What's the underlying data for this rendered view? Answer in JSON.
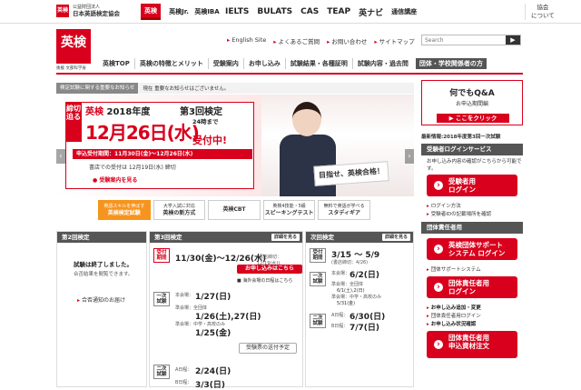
{
  "org": {
    "logo": "英検",
    "line1": "公益財団法人",
    "line2": "日本英語検定協会"
  },
  "brands": [
    "英検",
    "英検Jr.",
    "英検IBA",
    "IELTS",
    "BULATS",
    "CAS",
    "TEAP",
    "英ナビ",
    "通信講座"
  ],
  "assoc": {
    "line1": "協会",
    "line2": "について"
  },
  "logo": {
    "main": "英検",
    "sub": "後援 文部科学省"
  },
  "util": [
    "English Site",
    "よくあるご質問",
    "お問い合わせ",
    "サイトマップ"
  ],
  "search": {
    "placeholder": "Search",
    "button": "▶"
  },
  "gnav": [
    "英検TOP",
    "英検の特徴とメリット",
    "受験案内",
    "お申し込み",
    "試験結果・各種証明",
    "試験内容・過去問",
    "団体・学校関係者の方"
  ],
  "notice": {
    "label": "検定試験に関する重要なお知らせ",
    "text": "現在 重要なお知らせはございません。"
  },
  "hero": {
    "shime": "締切迫る",
    "title_a": "英検",
    "title_b": "2018年度",
    "round": "第3回検定",
    "date": "12月26日(水)",
    "until": "24時まで",
    "accept": "受付中!",
    "period": "申込受付期間：11月30日(金)〜12月26日(水)",
    "shop": "書店での受付は 12月19日(水) 締切",
    "guide": "受験案内を見る",
    "board": "目指せ、英検合格！",
    "prev": "‹",
    "next": "›"
  },
  "tabs": [
    {
      "top": "英語スキルを伸ばす",
      "main": "英検検定試験"
    },
    {
      "top": "大学入試に対応",
      "main": "英検の新方式"
    },
    {
      "top": "",
      "main": "英検CBT"
    },
    {
      "top": "英検4技能・5級",
      "main": "スピーキングテスト"
    },
    {
      "top": "無料で英語が学べる",
      "main": "スタディギア"
    }
  ],
  "col1": {
    "head": "第2回検定",
    "t1": "試験は終了しました。",
    "t2": "合否結果を閲覧できます。",
    "t3": "合否通知のお届け"
  },
  "col2": {
    "head": "第3回検定",
    "detail": "詳細を見る",
    "l_accept": "受付期間",
    "accept": "11/30(金)〜12/26(水)",
    "accept_note": "(書店締切：12/19(水))",
    "apply_btn": "お申し込みはこちら",
    "overseas": "海外会場の日程はこちら",
    "l1": "一次試験",
    "r1a": "本会場：",
    "r1b": "1/27(日)",
    "r1c": "準会場：全団体",
    "r1d": "1/26(土),27(日)",
    "r1e": "準会場：中学・高校のみ",
    "r1f": "1/25(金)",
    "ship_btn": "受験票の送付予定",
    "l2": "二次試験",
    "r2a": "A日程：",
    "r2b": "2/24(日)",
    "r2c": "B日程：",
    "r2d": "3/3(日)"
  },
  "col3": {
    "head": "次回検定",
    "detail": "詳細を見る",
    "l_accept": "受付期間",
    "accept": "3/15 〜 5/9",
    "accept_note": "(書店締切：4/26)",
    "l1": "一次試験",
    "r1a": "本会場：",
    "r1b": "6/2(日)",
    "r1c": "準会場：全団体",
    "r1d": "6/1(土),2(日)",
    "r1e": "準会場：中学・高校のみ",
    "r1f": "5/31(金)",
    "l2": "二次試験",
    "r2a": "A日程：",
    "r2b": "6/30(日)",
    "r2c": "B日程：",
    "r2d": "7/7(日)"
  },
  "side": {
    "qa1": "何でもQ&A",
    "qa2": "お申込期間編",
    "qa3": "▶ ここをクリック",
    "latest": "最新情報:2018年度第3回一次試験",
    "login_head": "受験者ログインサービス",
    "login_text": "お申し込み内容の確認がこちらから可能です。",
    "login_btn1": "受験者用",
    "login_btn2": "ログイン",
    "link1": "ログイン方法",
    "link2": "受験者IDの記載場所を確認",
    "group_head": "団体責任者用",
    "group_btn1": "英検団体サポート",
    "group_btn2": "システム ログイン",
    "link3": "団体サポートシステム",
    "group_btn3": "団体責任者用",
    "group_btn4": "ログイン",
    "link4": "お申し込み追加・変更",
    "link5": "団体責任者用ログイン",
    "link6": "お申し込み状況確認",
    "group_btn5": "団体責任者用",
    "group_btn6": "申込資材注文"
  }
}
